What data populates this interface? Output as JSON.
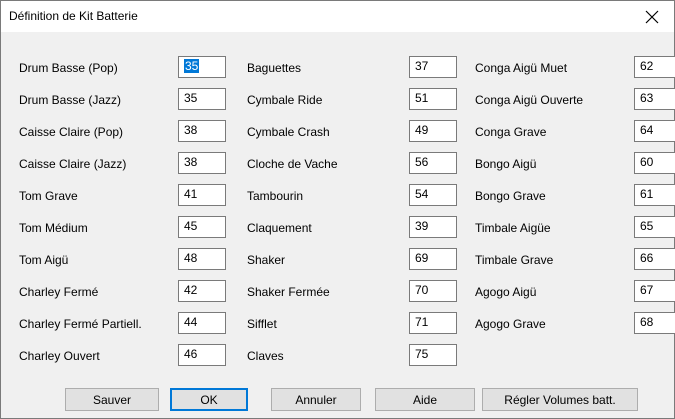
{
  "window": {
    "title": "Définition de Kit Batterie"
  },
  "columns": [
    [
      {
        "label": "Drum Basse (Pop)",
        "value": "35",
        "selected": true
      },
      {
        "label": "Drum Basse (Jazz)",
        "value": "35"
      },
      {
        "label": "Caisse Claire (Pop)",
        "value": "38"
      },
      {
        "label": "Caisse Claire (Jazz)",
        "value": "38"
      },
      {
        "label": "Tom Grave",
        "value": "41"
      },
      {
        "label": "Tom Médium",
        "value": "45"
      },
      {
        "label": "Tom Aigü",
        "value": "48"
      },
      {
        "label": "Charley Fermé",
        "value": "42"
      },
      {
        "label": "Charley Fermé Partiell.",
        "value": "44"
      },
      {
        "label": "Charley Ouvert",
        "value": "46"
      }
    ],
    [
      {
        "label": "Baguettes",
        "value": "37"
      },
      {
        "label": "Cymbale Ride",
        "value": "51"
      },
      {
        "label": "Cymbale Crash",
        "value": "49"
      },
      {
        "label": "Cloche de Vache",
        "value": "56"
      },
      {
        "label": "Tambourin",
        "value": "54"
      },
      {
        "label": "Claquement",
        "value": "39"
      },
      {
        "label": "Shaker",
        "value": "69"
      },
      {
        "label": "Shaker Fermée",
        "value": "70"
      },
      {
        "label": "Sifflet",
        "value": "71"
      },
      {
        "label": "Claves",
        "value": "75"
      }
    ],
    [
      {
        "label": "Conga Aigü Muet",
        "value": "62"
      },
      {
        "label": "Conga Aigü Ouverte",
        "value": "63"
      },
      {
        "label": "Conga Grave",
        "value": "64"
      },
      {
        "label": "Bongo Aigü",
        "value": "60"
      },
      {
        "label": "Bongo Grave",
        "value": "61"
      },
      {
        "label": "Timbale Aigüe",
        "value": "65"
      },
      {
        "label": "Timbale Grave",
        "value": "66"
      },
      {
        "label": "Agogo Aigü",
        "value": "67"
      },
      {
        "label": "Agogo Grave",
        "value": "68"
      }
    ]
  ],
  "buttons": {
    "save": "Sauver",
    "ok": "OK",
    "cancel": "Annuler",
    "help": "Aide",
    "volumes": "Régler Volumes batt."
  },
  "icons": {
    "close": "close-icon"
  },
  "colors": {
    "selection": "#0078d7"
  }
}
